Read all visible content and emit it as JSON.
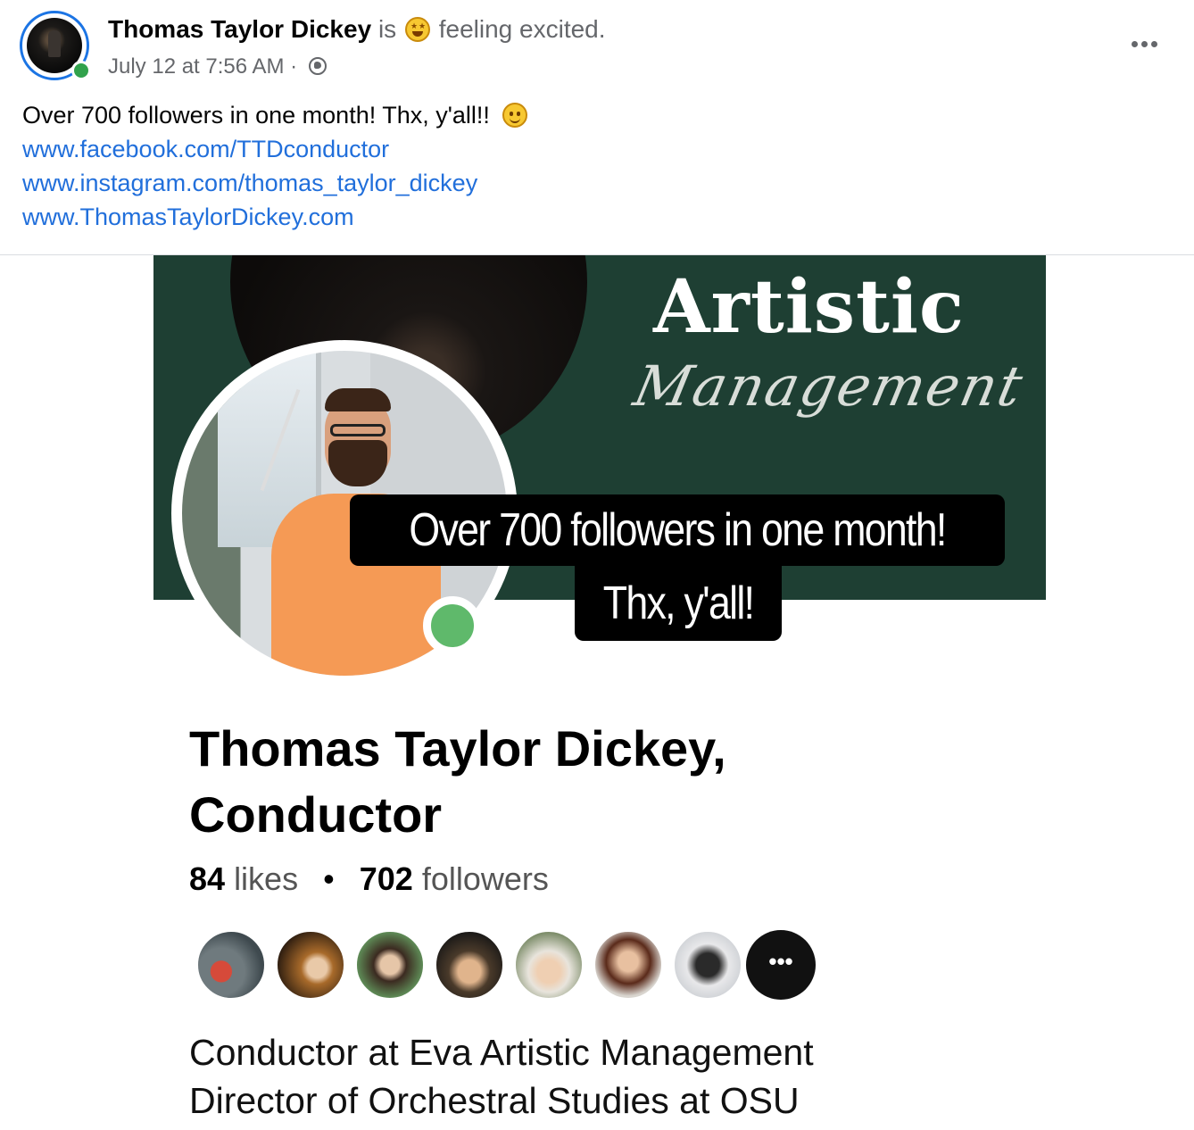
{
  "post": {
    "author": "Thomas Taylor Dickey",
    "is_word": "is",
    "feeling_text": "feeling excited.",
    "timestamp": "July 12 at 7:56 AM",
    "separator": "·",
    "privacy_icon": "globe-icon",
    "more_icon": "more-options-icon",
    "text": "Over 700 followers in one month!  Thx, y'all!!",
    "links": [
      "www.facebook.com/TTDconductor",
      "www.instagram.com/thomas_taylor_dickey",
      "www.ThomasTaylorDickey.com"
    ]
  },
  "shared_image": {
    "banner_title": "Artistic",
    "banner_script": "Management",
    "caption_line_1": "Over 700 followers in one month!",
    "caption_line_2": "Thx, y'all!",
    "page_name_line_1": "Thomas Taylor Dickey,",
    "page_name_line_2": "Conductor",
    "likes_count": "84",
    "likes_label": "likes",
    "stats_separator": "•",
    "followers_count": "702",
    "followers_label": "followers",
    "more_friends_label": "•••",
    "bio_line_1": "Conductor at Eva Artistic Management",
    "bio_line_2": "Director of Orchestral Studies at OSU"
  },
  "colors": {
    "link": "#216fdb",
    "banner_bg": "#1e3f33",
    "online": "#31a24c",
    "story_ring": "#1b74e4"
  }
}
